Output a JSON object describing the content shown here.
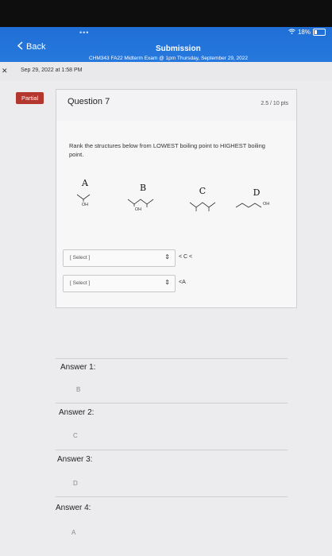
{
  "status": {
    "battery_text": "18%"
  },
  "nav": {
    "back_label": "Back",
    "title": "Submission",
    "subtitle": "CHM343 FA22 Midterm Exam @ 1pm Thursday, September 29, 2022"
  },
  "submission": {
    "date": "Sep 29, 2022 at 1:58 PM"
  },
  "question": {
    "badge": "Partial",
    "title": "Question 7",
    "points": "2.5 / 10 pts",
    "prompt": "Rank the structures below from LOWEST boiling point to HIGHEST boiling point.",
    "molecules": [
      {
        "label": "A",
        "group": "OH"
      },
      {
        "label": "B",
        "group": "OH"
      },
      {
        "label": "C",
        "group": ""
      },
      {
        "label": "D",
        "group": "OH"
      }
    ],
    "selects": [
      {
        "placeholder": "[ Select ]",
        "suffix": "< C <"
      },
      {
        "placeholder": "[ Select ]",
        "suffix": "<A"
      }
    ]
  },
  "answers": [
    {
      "label": "Answer 1:",
      "value": "B"
    },
    {
      "label": "Answer 2:",
      "value": "C"
    },
    {
      "label": "Answer 3:",
      "value": "D"
    },
    {
      "label": "Answer 4:",
      "value": "A"
    }
  ],
  "colors": {
    "header": "#2a7ce0",
    "partial_badge": "#b3362f",
    "background": "#ececef"
  }
}
